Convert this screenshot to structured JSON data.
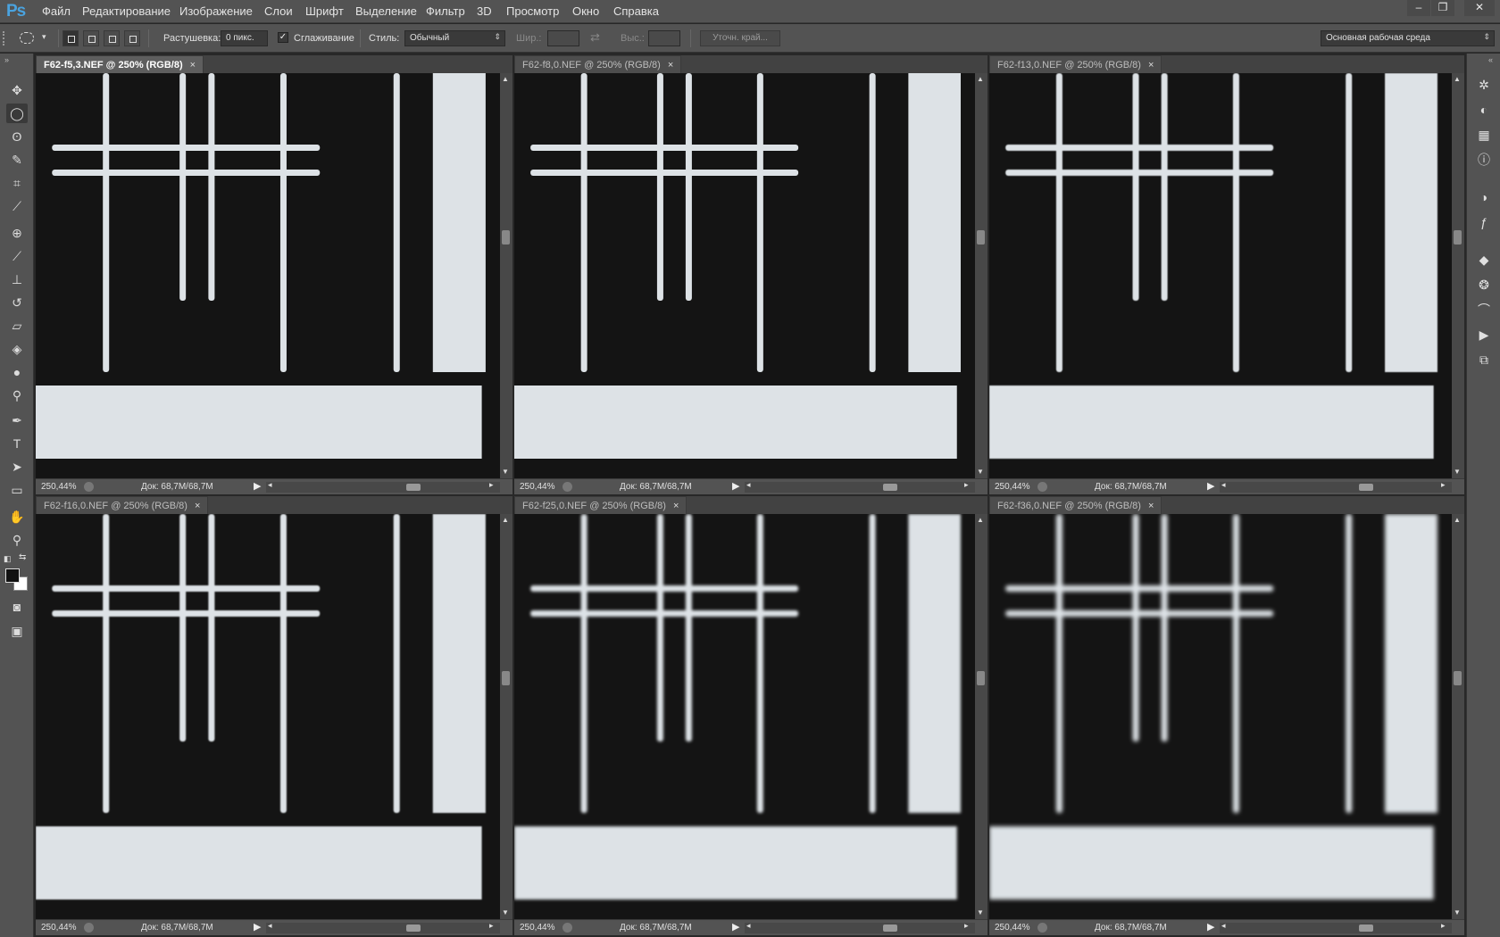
{
  "app": {
    "logo": "Ps"
  },
  "menu": [
    "Файл",
    "Редактирование",
    "Изображение",
    "Слои",
    "Шрифт",
    "Выделение",
    "Фильтр",
    "3D",
    "Просмотр",
    "Окно",
    "Справка"
  ],
  "window_controls": {
    "minimize": "–",
    "restore": "❐",
    "close": "✕"
  },
  "options": {
    "feather_label": "Растушевка:",
    "feather_value": "0 пикс.",
    "antialias_label": "Сглаживание",
    "antialias_checked": "✓",
    "style_label": "Стиль:",
    "style_value": "Обычный",
    "width_label": "Шир.:",
    "height_label": "Выс.:",
    "refine_edge": "Уточн. край...",
    "workspace": "Основная рабочая среда"
  },
  "tools": [
    "move-tool",
    "elliptical-marquee-tool",
    "lasso-tool",
    "quick-selection-tool",
    "crop-tool",
    "eyedropper-tool",
    "spot-healing-tool",
    "brush-tool",
    "clone-stamp-tool",
    "history-brush-tool",
    "eraser-tool",
    "paint-bucket-tool",
    "blur-tool",
    "dodge-tool",
    "pen-tool",
    "type-tool",
    "path-selection-tool",
    "rectangle-tool",
    "hand-tool",
    "zoom-tool"
  ],
  "colors": {
    "foreground": "#111111",
    "background": "#ffffff",
    "accent": "#4aa3df",
    "chrome": "#535353"
  },
  "documents": [
    {
      "title": "F62-f5,3.NEF @ 250% (RGB/8)",
      "close": "×",
      "zoom": "250,44%",
      "doc_size": "Док: 68,7M/68,7M",
      "active": true,
      "blur": 0
    },
    {
      "title": "F62-f8,0.NEF @ 250% (RGB/8)",
      "close": "×",
      "zoom": "250,44%",
      "doc_size": "Док: 68,7M/68,7M",
      "active": false,
      "blur": 0.3
    },
    {
      "title": "F62-f13,0.NEF @ 250% (RGB/8)",
      "close": "×",
      "zoom": "250,44%",
      "doc_size": "Док: 68,7M/68,7M",
      "active": false,
      "blur": 0.6
    },
    {
      "title": "F62-f16,0.NEF @ 250% (RGB/8)",
      "close": "×",
      "zoom": "250,44%",
      "doc_size": "Док: 68,7M/68,7M",
      "active": false,
      "blur": 0.9
    },
    {
      "title": "F62-f25,0.NEF @ 250% (RGB/8)",
      "close": "×",
      "zoom": "250,44%",
      "doc_size": "Док: 68,7M/68,7M",
      "active": false,
      "blur": 1.6
    },
    {
      "title": "F62-f36,0.NEF @ 250% (RGB/8)",
      "close": "×",
      "zoom": "250,44%",
      "doc_size": "Док: 68,7M/68,7M",
      "active": false,
      "blur": 2.4
    }
  ],
  "panels": [
    "navigator-icon",
    "color-icon",
    "swatches-icon",
    "info-icon",
    "adjustments-icon",
    "styles-icon",
    "layers-icon",
    "channels-icon",
    "paths-icon",
    "actions-icon",
    "history-icon"
  ]
}
